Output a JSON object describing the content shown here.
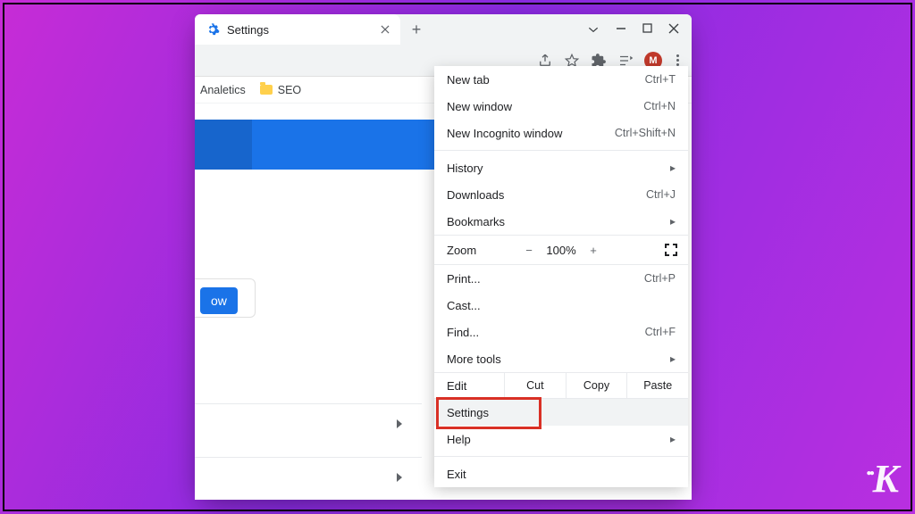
{
  "tab": {
    "title": "Settings"
  },
  "bookmarks": [
    {
      "label": "Analetics"
    },
    {
      "label": "SEO"
    }
  ],
  "avatar_initial": "M",
  "content": {
    "partial_button": "ow"
  },
  "menu": {
    "new_tab": {
      "label": "New tab",
      "shortcut": "Ctrl+T"
    },
    "new_window": {
      "label": "New window",
      "shortcut": "Ctrl+N"
    },
    "new_incognito": {
      "label": "New Incognito window",
      "shortcut": "Ctrl+Shift+N"
    },
    "history": {
      "label": "History"
    },
    "downloads": {
      "label": "Downloads",
      "shortcut": "Ctrl+J"
    },
    "bookmarks": {
      "label": "Bookmarks"
    },
    "zoom": {
      "label": "Zoom",
      "minus": "−",
      "value": "100%",
      "plus": "+"
    },
    "print": {
      "label": "Print...",
      "shortcut": "Ctrl+P"
    },
    "cast": {
      "label": "Cast..."
    },
    "find": {
      "label": "Find...",
      "shortcut": "Ctrl+F"
    },
    "more_tools": {
      "label": "More tools"
    },
    "edit": {
      "label": "Edit",
      "cut": "Cut",
      "copy": "Copy",
      "paste": "Paste"
    },
    "settings": {
      "label": "Settings"
    },
    "help": {
      "label": "Help"
    },
    "exit": {
      "label": "Exit"
    }
  },
  "submenu_arrow": "▸",
  "watermark": "K"
}
